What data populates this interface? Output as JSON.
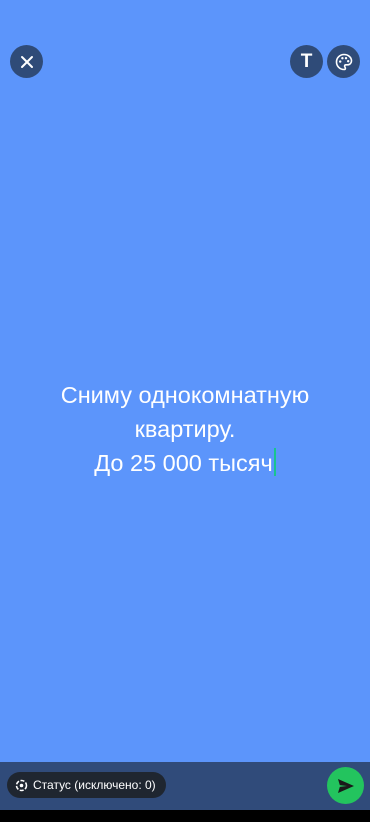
{
  "toolbar": {
    "close_icon": "close-icon",
    "text_tool_label": "T",
    "palette_icon": "palette-icon"
  },
  "status": {
    "lines": [
      "Сниму однокомнатную",
      "квартиру.",
      "До 25 000 тысяч"
    ],
    "background_color": "#5c95fb",
    "text_color": "#ffffff",
    "cursor_color": "#19c48f"
  },
  "footer": {
    "privacy_label": "Статус (исключено: 0)",
    "privacy_icon": "status-privacy-icon",
    "send_icon": "send-icon",
    "send_color": "#23c45e"
  }
}
